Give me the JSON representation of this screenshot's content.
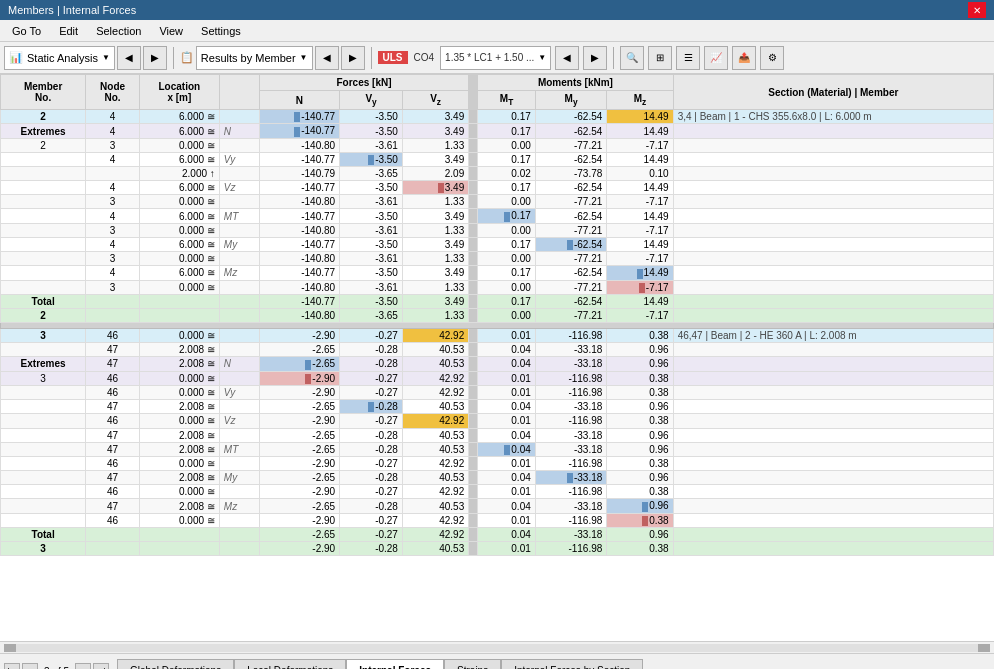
{
  "titleBar": {
    "title": "Members | Internal Forces",
    "closeLabel": "✕"
  },
  "menuBar": {
    "items": [
      "Go To",
      "Edit",
      "Selection",
      "View",
      "Settings"
    ]
  },
  "toolbar": {
    "analysisLabel": "Static Analysis",
    "resultsLabel": "Results by Member",
    "uls": "ULS",
    "co4": "CO4",
    "formula": "1.35 * LC1 + 1.50 ...",
    "icons": [
      "search",
      "grid",
      "table",
      "export",
      "settings"
    ]
  },
  "table": {
    "headers": {
      "memberNo": "Member No.",
      "nodeNo": "Node No.",
      "locationX": "Location x [m]",
      "forcesGroup": "Forces [kN]",
      "n": "N",
      "vy": "Vy",
      "vz": "Vz",
      "momentsGroup": "Moments [kNm]",
      "mt": "MT",
      "my": "My",
      "mz": "Mz",
      "sectionMaterial": "Section (Material) | Member"
    },
    "rows": [
      {
        "type": "member",
        "memberNo": "2",
        "nodeNo": "4",
        "location": "6.000",
        "suffix": "≅",
        "label": "",
        "n": "-140.77",
        "vy": "-3.50",
        "vz": "3.49",
        "mt": "0.17",
        "my": "-62.54",
        "mz": "14.49",
        "section": "3,4 | Beam | 1 - CHS 355.6x8.0 | L: 6.000 m",
        "nBar": "blue",
        "vyBar": "",
        "vzBar": "",
        "mtBar": "",
        "myBar": "",
        "mzBar": "orange"
      },
      {
        "type": "extremes",
        "memberNo": "Extremes",
        "nodeNo": "4",
        "location": "6.000",
        "suffix": "≅",
        "label": "N",
        "n": "-140.77",
        "vy": "-3.50",
        "vz": "3.49",
        "mt": "0.17",
        "my": "-62.54",
        "mz": "14.49",
        "section": "",
        "nBar": "blue"
      },
      {
        "type": "normal",
        "memberNo": "2",
        "nodeNo": "3",
        "location": "0.000",
        "suffix": "≅",
        "label": "",
        "n": "-140.80",
        "vy": "-3.61",
        "vz": "1.33",
        "mt": "0.00",
        "my": "-77.21",
        "mz": "-7.17",
        "section": "",
        "nBar": ""
      },
      {
        "type": "normal",
        "memberNo": "",
        "nodeNo": "4",
        "location": "6.000",
        "suffix": "≅",
        "label": "Vy",
        "n": "-140.77",
        "vy": "-3.50",
        "vz": "3.49",
        "mt": "0.17",
        "my": "-62.54",
        "mz": "14.49",
        "section": "",
        "vyBar": "blue"
      },
      {
        "type": "normal",
        "memberNo": "",
        "nodeNo": "",
        "location": "2.000",
        "suffix": "↑",
        "label": "",
        "n": "-140.79",
        "vy": "-3.65",
        "vz": "2.09",
        "mt": "0.02",
        "my": "-73.78",
        "mz": "0.10",
        "section": ""
      },
      {
        "type": "normal",
        "memberNo": "",
        "nodeNo": "4",
        "location": "6.000",
        "suffix": "≅",
        "label": "Vz",
        "n": "-140.77",
        "vy": "-3.50",
        "vz": "3.49",
        "mt": "0.17",
        "my": "-62.54",
        "mz": "14.49",
        "section": "",
        "vzBar": "red"
      },
      {
        "type": "normal",
        "memberNo": "",
        "nodeNo": "3",
        "location": "0.000",
        "suffix": "≅",
        "label": "",
        "n": "-140.80",
        "vy": "-3.61",
        "vz": "1.33",
        "mt": "0.00",
        "my": "-77.21",
        "mz": "-7.17",
        "section": ""
      },
      {
        "type": "normal",
        "memberNo": "",
        "nodeNo": "4",
        "location": "6.000",
        "suffix": "≅",
        "label": "MT",
        "n": "-140.77",
        "vy": "-3.50",
        "vz": "3.49",
        "mt": "0.17",
        "my": "-62.54",
        "mz": "14.49",
        "section": "",
        "mtBar": "blue"
      },
      {
        "type": "normal",
        "memberNo": "",
        "nodeNo": "3",
        "location": "0.000",
        "suffix": "≅",
        "label": "",
        "n": "-140.80",
        "vy": "-3.61",
        "vz": "1.33",
        "mt": "0.00",
        "my": "-77.21",
        "mz": "-7.17",
        "section": ""
      },
      {
        "type": "normal",
        "memberNo": "",
        "nodeNo": "4",
        "location": "6.000",
        "suffix": "≅",
        "label": "My",
        "n": "-140.77",
        "vy": "-3.50",
        "vz": "3.49",
        "mt": "0.17",
        "my": "-62.54",
        "mz": "14.49",
        "section": "",
        "myBar": "blue"
      },
      {
        "type": "normal",
        "memberNo": "",
        "nodeNo": "3",
        "location": "0.000",
        "suffix": "≅",
        "label": "",
        "n": "-140.80",
        "vy": "-3.61",
        "vz": "1.33",
        "mt": "0.00",
        "my": "-77.21",
        "mz": "-7.17",
        "section": ""
      },
      {
        "type": "normal",
        "memberNo": "",
        "nodeNo": "4",
        "location": "6.000",
        "suffix": "≅",
        "label": "Mz",
        "n": "-140.77",
        "vy": "-3.50",
        "vz": "3.49",
        "mt": "0.17",
        "my": "-62.54",
        "mz": "14.49",
        "section": "",
        "mzBar": "blue"
      },
      {
        "type": "normal",
        "memberNo": "",
        "nodeNo": "3",
        "location": "0.000",
        "suffix": "≅",
        "label": "",
        "n": "-140.80",
        "vy": "-3.61",
        "vz": "1.33",
        "mt": "0.00",
        "my": "-77.21",
        "mz": "-7.17",
        "section": "",
        "mzBar": "red"
      },
      {
        "type": "total",
        "memberNo": "Total",
        "nodeNo": "",
        "location": "",
        "suffix": "",
        "label": "",
        "n": "-140.77",
        "vy": "-3.50",
        "vz": "3.49",
        "mt": "0.17",
        "my": "-62.54",
        "mz": "14.49",
        "section": ""
      },
      {
        "type": "total2",
        "memberNo": "2",
        "nodeNo": "",
        "location": "",
        "suffix": "",
        "label": "",
        "n": "-140.80",
        "vy": "-3.65",
        "vz": "1.33",
        "mt": "0.00",
        "my": "-77.21",
        "mz": "-7.17",
        "section": ""
      },
      {
        "type": "sep"
      },
      {
        "type": "member",
        "memberNo": "3",
        "nodeNo": "46",
        "location": "0.000",
        "suffix": "≅",
        "label": "",
        "n": "-2.90",
        "vy": "-0.27",
        "vz": "42.92",
        "mt": "0.01",
        "my": "-116.98",
        "mz": "0.38",
        "section": "46,47 | Beam | 2 - HE 360 A | L: 2.008 m",
        "vzBar": "orange"
      },
      {
        "type": "normal2",
        "memberNo": "",
        "nodeNo": "47",
        "location": "2.008",
        "suffix": "≅",
        "label": "",
        "n": "-2.65",
        "vy": "-0.28",
        "vz": "40.53",
        "mt": "0.04",
        "my": "-33.18",
        "mz": "0.96",
        "section": ""
      },
      {
        "type": "extremes",
        "memberNo": "Extremes",
        "nodeNo": "47",
        "location": "2.008",
        "suffix": "≅",
        "label": "N",
        "n": "-2.65",
        "vy": "-0.28",
        "vz": "40.53",
        "mt": "0.04",
        "my": "-33.18",
        "mz": "0.96",
        "section": "",
        "nBar": "blue"
      },
      {
        "type": "label3",
        "memberNo": "3",
        "nodeNo": "46",
        "location": "0.000",
        "suffix": "≅",
        "label": "",
        "n": "-2.90",
        "vy": "-0.27",
        "vz": "42.92",
        "mt": "0.01",
        "my": "-116.98",
        "mz": "0.38",
        "section": "",
        "nBar": "red"
      },
      {
        "type": "normal",
        "memberNo": "",
        "nodeNo": "46",
        "location": "0.000",
        "suffix": "≅",
        "label": "Vy",
        "n": "-2.90",
        "vy": "-0.27",
        "vz": "42.92",
        "mt": "0.01",
        "my": "-116.98",
        "mz": "0.38",
        "section": ""
      },
      {
        "type": "normal",
        "memberNo": "",
        "nodeNo": "47",
        "location": "2.008",
        "suffix": "≅",
        "label": "",
        "n": "-2.65",
        "vy": "-0.28",
        "vz": "40.53",
        "mt": "0.04",
        "my": "-33.18",
        "mz": "0.96",
        "section": "",
        "vyBar": "blue"
      },
      {
        "type": "normal",
        "memberNo": "",
        "nodeNo": "46",
        "location": "0.000",
        "suffix": "≅",
        "label": "Vz",
        "n": "-2.90",
        "vy": "-0.27",
        "vz": "42.92",
        "mt": "0.01",
        "my": "-116.98",
        "mz": "0.38",
        "section": "",
        "vzBar": "orange"
      },
      {
        "type": "normal",
        "memberNo": "",
        "nodeNo": "47",
        "location": "2.008",
        "suffix": "≅",
        "label": "",
        "n": "-2.65",
        "vy": "-0.28",
        "vz": "40.53",
        "mt": "0.04",
        "my": "-33.18",
        "mz": "0.96",
        "section": ""
      },
      {
        "type": "normal",
        "memberNo": "",
        "nodeNo": "47",
        "location": "2.008",
        "suffix": "≅",
        "label": "MT",
        "n": "-2.65",
        "vy": "-0.28",
        "vz": "40.53",
        "mt": "0.04",
        "my": "-33.18",
        "mz": "0.96",
        "section": "",
        "mtBar": "blue"
      },
      {
        "type": "normal",
        "memberNo": "",
        "nodeNo": "46",
        "location": "0.000",
        "suffix": "≅",
        "label": "",
        "n": "-2.90",
        "vy": "-0.27",
        "vz": "42.92",
        "mt": "0.01",
        "my": "-116.98",
        "mz": "0.38",
        "section": ""
      },
      {
        "type": "normal",
        "memberNo": "",
        "nodeNo": "47",
        "location": "2.008",
        "suffix": "≅",
        "label": "My",
        "n": "-2.65",
        "vy": "-0.28",
        "vz": "40.53",
        "mt": "0.04",
        "my": "-33.18",
        "mz": "0.96",
        "section": "",
        "myBar": "blue"
      },
      {
        "type": "normal",
        "memberNo": "",
        "nodeNo": "46",
        "location": "0.000",
        "suffix": "≅",
        "label": "",
        "n": "-2.90",
        "vy": "-0.27",
        "vz": "42.92",
        "mt": "0.01",
        "my": "-116.98",
        "mz": "0.38",
        "section": ""
      },
      {
        "type": "normal",
        "memberNo": "",
        "nodeNo": "47",
        "location": "2.008",
        "suffix": "≅",
        "label": "Mz",
        "n": "-2.65",
        "vy": "-0.28",
        "vz": "40.53",
        "mt": "0.04",
        "my": "-33.18",
        "mz": "0.96",
        "section": "",
        "mzBar": "blue"
      },
      {
        "type": "normal",
        "memberNo": "",
        "nodeNo": "46",
        "location": "0.000",
        "suffix": "≅",
        "label": "",
        "n": "-2.90",
        "vy": "-0.27",
        "vz": "42.92",
        "mt": "0.01",
        "my": "-116.98",
        "mz": "0.38",
        "section": "",
        "mzBar": "red"
      },
      {
        "type": "total",
        "memberNo": "Total",
        "nodeNo": "",
        "location": "",
        "suffix": "",
        "label": "",
        "n": "-2.65",
        "vy": "-0.27",
        "vz": "42.92",
        "mt": "0.04",
        "my": "-33.18",
        "mz": "0.96",
        "section": ""
      },
      {
        "type": "total2",
        "memberNo": "3",
        "nodeNo": "",
        "location": "",
        "suffix": "",
        "label": "",
        "n": "-2.90",
        "vy": "-0.28",
        "vz": "40.53",
        "mt": "0.01",
        "my": "-116.98",
        "mz": "0.38",
        "section": ""
      }
    ]
  },
  "bottomBar": {
    "pageLabel": "3 of 5",
    "tabs": [
      "Global Deformations",
      "Local Deformations",
      "Internal Forces",
      "Strains",
      "Internal Forces by Section"
    ]
  }
}
